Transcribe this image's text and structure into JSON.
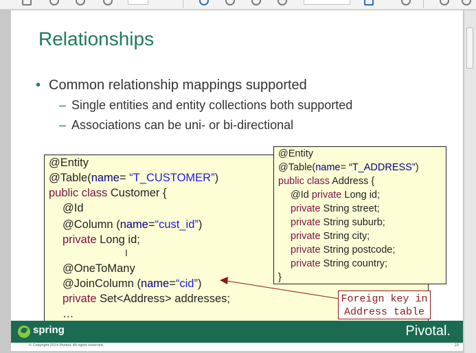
{
  "slide": {
    "title": "Relationships",
    "bullet": "Common relationship mappings supported",
    "subbullets": [
      "Single entities and entity collections both supported",
      "Associations can be uni- or bi-directional"
    ]
  },
  "customer_code": {
    "l1": "@Entity",
    "l2a": "@Table(",
    "l2b": "name",
    "l2c": "= ",
    "l2d": "“T_CUSTOMER”",
    "l2e": ")",
    "l3a": "public class",
    "l3b": " Customer {",
    "l4": "@Id",
    "l5a": "@Column (",
    "l5b": "name",
    "l5c": "=",
    "l5d": "“cust_id”",
    "l5e": ")",
    "l6a": "private",
    "l6b": " Long id;",
    "l7": "@OneToMany",
    "l8a": "@JoinColumn (",
    "l8b": "name",
    "l8c": "=",
    "l8d": "“cid”",
    "l8e": ")",
    "l9a": "private",
    "l9b": " Set<Address> addresses;",
    "l10": "…"
  },
  "address_code": {
    "l1": "@Entity",
    "l2a": "@Table(",
    "l2b": "name",
    "l2c": "= ",
    "l2d": "“T_ADDRESS”",
    "l2e": ")",
    "l3a": "public class",
    "l3b": " Address {",
    "l4a": "@Id ",
    "l4b": "private",
    "l4c": " Long id;",
    "l5a": "private",
    "l5b": " String street;",
    "l6a": "private",
    "l6b": " String suburb;",
    "l7a": "private",
    "l7b": " String city;",
    "l8a": "private",
    "l8b": " String postcode;",
    "l9a": "private",
    "l9b": " String country;",
    "l10": "}"
  },
  "callout": {
    "line1": "Foreign key in",
    "line2": "Address table"
  },
  "footer": {
    "spring": "spring",
    "pivotal": "Pivotal.",
    "copyright": "© Copyright 2014 Pivotal. All rights reserved.",
    "page": "15"
  },
  "colors": {
    "accent": "#1f7a5a",
    "keyword": "#7a1142",
    "code_bg": "#fefed6",
    "callout": "#8b1a1a"
  }
}
